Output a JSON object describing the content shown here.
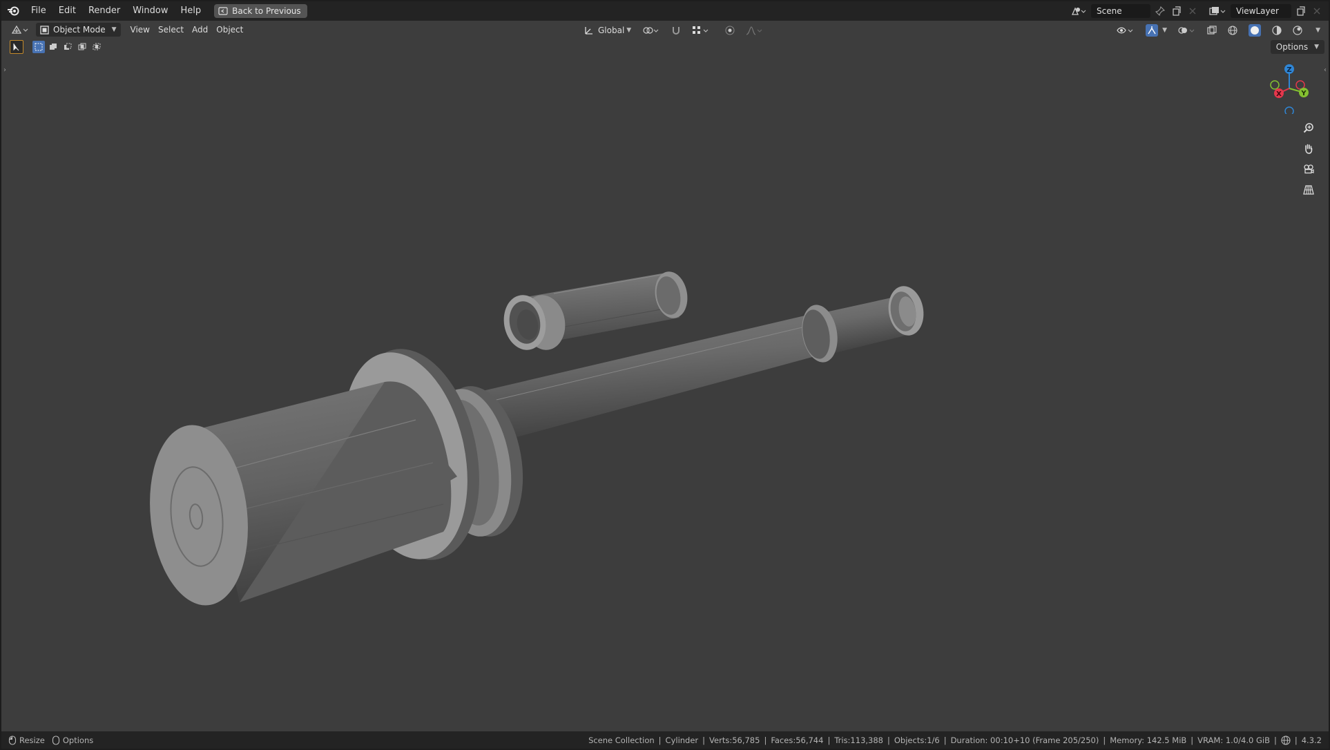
{
  "menubar": {
    "items": [
      "File",
      "Edit",
      "Render",
      "Window",
      "Help"
    ],
    "back_button": "Back to Previous",
    "scene_name": "Scene",
    "view_layer": "ViewLayer"
  },
  "viewport_header": {
    "mode": "Object Mode",
    "menus": [
      "View",
      "Select",
      "Add",
      "Object"
    ],
    "orientation": "Global",
    "options_label": "Options"
  },
  "gizmo": {
    "axes": {
      "x": "X",
      "y": "Y",
      "z": "Z"
    },
    "colors": {
      "x": "#e5374c",
      "y": "#84c131",
      "z": "#2f86d6"
    }
  },
  "statusbar": {
    "resize_label": "Resize",
    "options_label": "Options",
    "collection": "Scene Collection",
    "object": "Cylinder",
    "verts": "Verts:56,785",
    "faces": "Faces:56,744",
    "tris": "Tris:113,388",
    "objects": "Objects:1/6",
    "duration": "Duration: 00:10+10 (Frame 205/250)",
    "memory": "Memory: 142.5 MiB",
    "vram": "VRAM: 1.0/4.0 GiB",
    "version": "4.3.2"
  },
  "colors": {
    "accent": "#4772b3",
    "viewport_bg": "#3d3d3d",
    "bar_bg": "#232323"
  }
}
